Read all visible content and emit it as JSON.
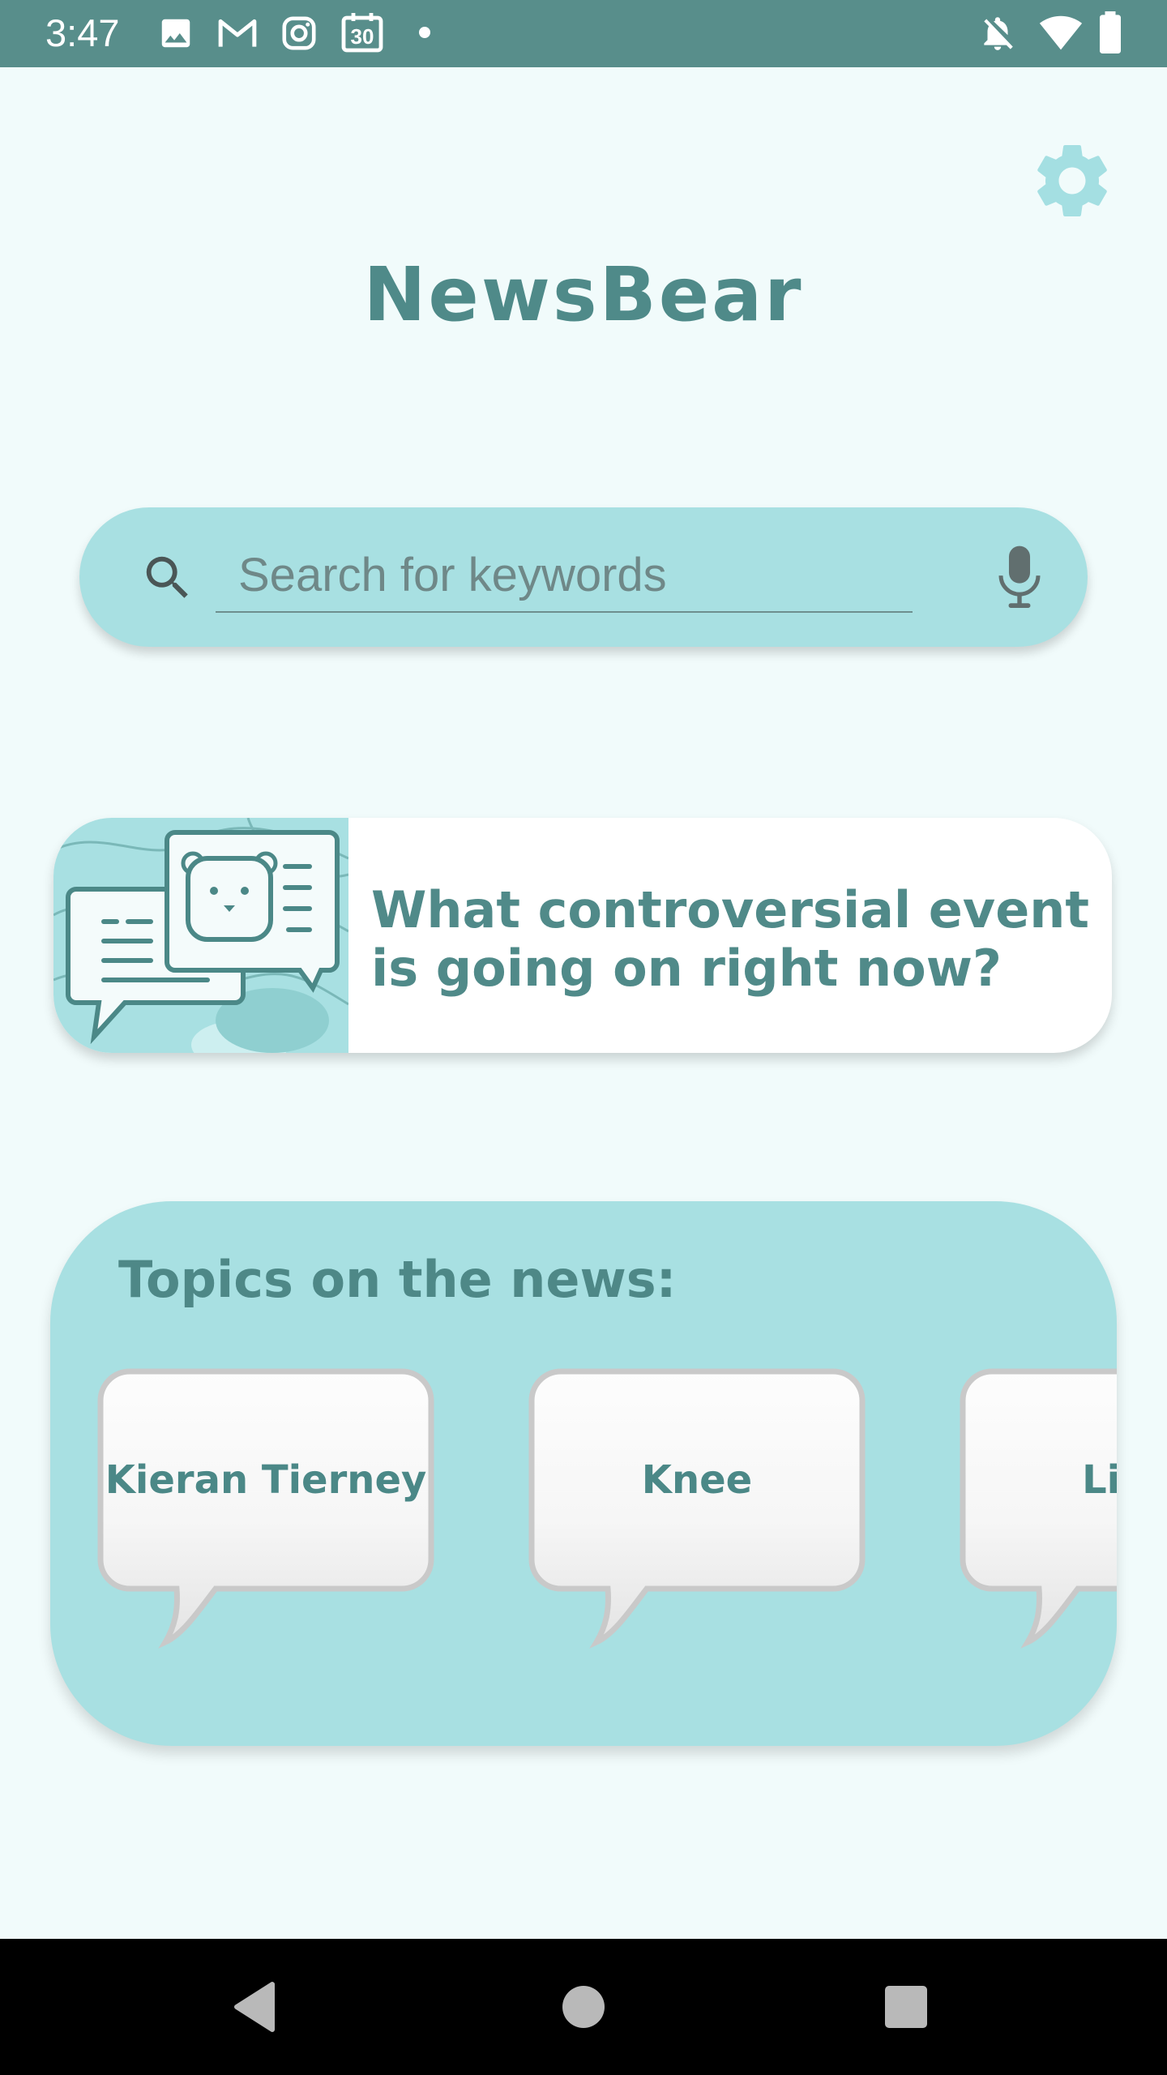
{
  "status_bar": {
    "time": "3:47",
    "icons_left": [
      "image-icon",
      "gmail-icon",
      "instagram-icon",
      "calendar-icon",
      "dot-icon"
    ],
    "calendar_day": "30",
    "icons_right": [
      "notifications-off-icon",
      "wifi-icon",
      "battery-icon"
    ]
  },
  "header": {
    "title": "NewsBear",
    "settings_icon": "gear-icon"
  },
  "search": {
    "placeholder": "Search for keywords",
    "value": "",
    "search_icon": "search-icon",
    "mic_icon": "microphone-icon"
  },
  "event_card": {
    "text": "What controversial event is going on right now?",
    "image": "bear-chat-bubbles-illustration"
  },
  "topics": {
    "title": "Topics on the news:",
    "items": [
      {
        "label": "Kieran Tierney"
      },
      {
        "label": "Knee"
      },
      {
        "label": "Liga"
      }
    ]
  },
  "nav_bar": {
    "buttons": [
      "back-icon",
      "home-icon",
      "recents-icon"
    ]
  },
  "colors": {
    "status_bar": "#588e8b",
    "background": "#f1fbfb",
    "accent_teal": "#a8e0e2",
    "text_teal": "#4f8a89",
    "card": "#ffffff"
  }
}
